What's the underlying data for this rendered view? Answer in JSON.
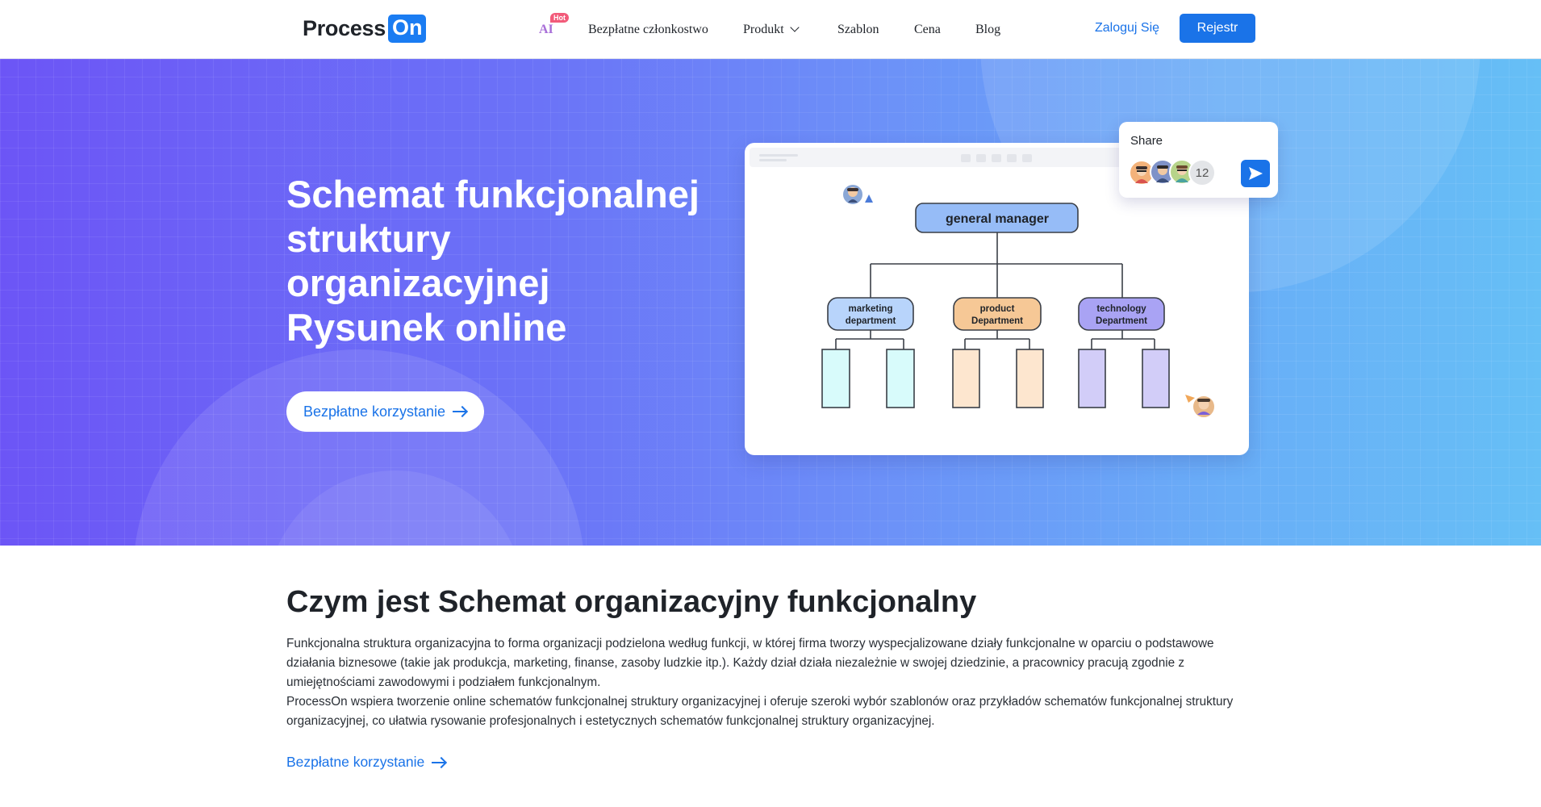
{
  "header": {
    "logo_part1": "Process",
    "logo_part2": "On",
    "ai_label": "AI",
    "hot_badge": "Hot",
    "nav": {
      "membership": "Bezpłatne członkostwo",
      "product": "Produkt",
      "template": "Szablon",
      "price": "Cena",
      "blog": "Blog"
    },
    "login": "Zaloguj Się",
    "register": "Rejestr"
  },
  "hero": {
    "title_lines": [
      "Schemat funkcjonalnej",
      "struktury",
      "organizacyjnej",
      "Rysunek online"
    ],
    "cta": "Bezpłatne korzystanie"
  },
  "illustration": {
    "share_label": "Share",
    "collaborator_count": "12",
    "root_node": "general manager",
    "departments": [
      {
        "line1": "marketing",
        "line2": "department",
        "color": "#b8d4fb"
      },
      {
        "line1": "product",
        "line2": "Department",
        "color": "#f6c896"
      },
      {
        "line1": "technology",
        "line2": "Department",
        "color": "#a9a3f4"
      }
    ],
    "leaf_colors": [
      "#d8fbfb",
      "#fde6cf",
      "#d2cdf8"
    ],
    "root_color": "#96bcf7"
  },
  "content": {
    "heading": "Czym jest Schemat organizacyjny funkcjonalny",
    "paragraph1": "Funkcjonalna struktura organizacyjna to forma organizacji podzielona według funkcji, w której firma tworzy wyspecjalizowane działy funkcjonalne w oparciu o podstawowe działania biznesowe (takie jak produkcja, marketing, finanse, zasoby ludzkie itp.). Każdy dział działa niezależnie w swojej dziedzinie, a pracownicy pracują zgodnie z umiejętnościami zawodowymi i podziałem funkcjonalnym.",
    "paragraph2": "ProcessOn wspiera tworzenie online schematów funkcjonalnej struktury organizacyjnej i oferuje szeroki wybór szablonów oraz przykładów schematów funkcjonalnej struktury organizacyjnej, co ułatwia rysowanie profesjonalnych i estetycznych schematów funkcjonalnej struktury organizacyjnej.",
    "cta": "Bezpłatne korzystanie"
  },
  "colors": {
    "accent": "#1a73e8",
    "hero_start": "#6c55f6",
    "hero_end": "#66bff6"
  }
}
